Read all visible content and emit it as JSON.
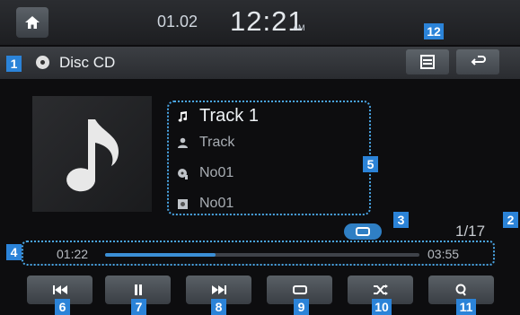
{
  "header": {
    "date": "01.02",
    "time": "12:21",
    "ampm": "AM"
  },
  "source": {
    "label": "Disc CD"
  },
  "track": {
    "title": "Track 1",
    "artist": "Track",
    "album": "No01",
    "folder": "No01",
    "index": "1/17"
  },
  "progress": {
    "elapsed": "01:22",
    "total": "03:55",
    "fraction": 0.35
  },
  "callouts": [
    "1",
    "2",
    "3",
    "4",
    "5",
    "6",
    "7",
    "8",
    "9",
    "10",
    "11",
    "12"
  ],
  "colors": {
    "accent": "#2b83d8",
    "progress": "#3b8fd6"
  },
  "icons": {
    "home": "home-icon",
    "list": "list-icon",
    "back": "back-arrow-icon",
    "prev": "skip-previous-icon",
    "pause": "pause-icon",
    "next": "skip-next-icon",
    "repeat": "repeat-icon",
    "shuffle": "shuffle-icon",
    "search": "search-icon"
  }
}
